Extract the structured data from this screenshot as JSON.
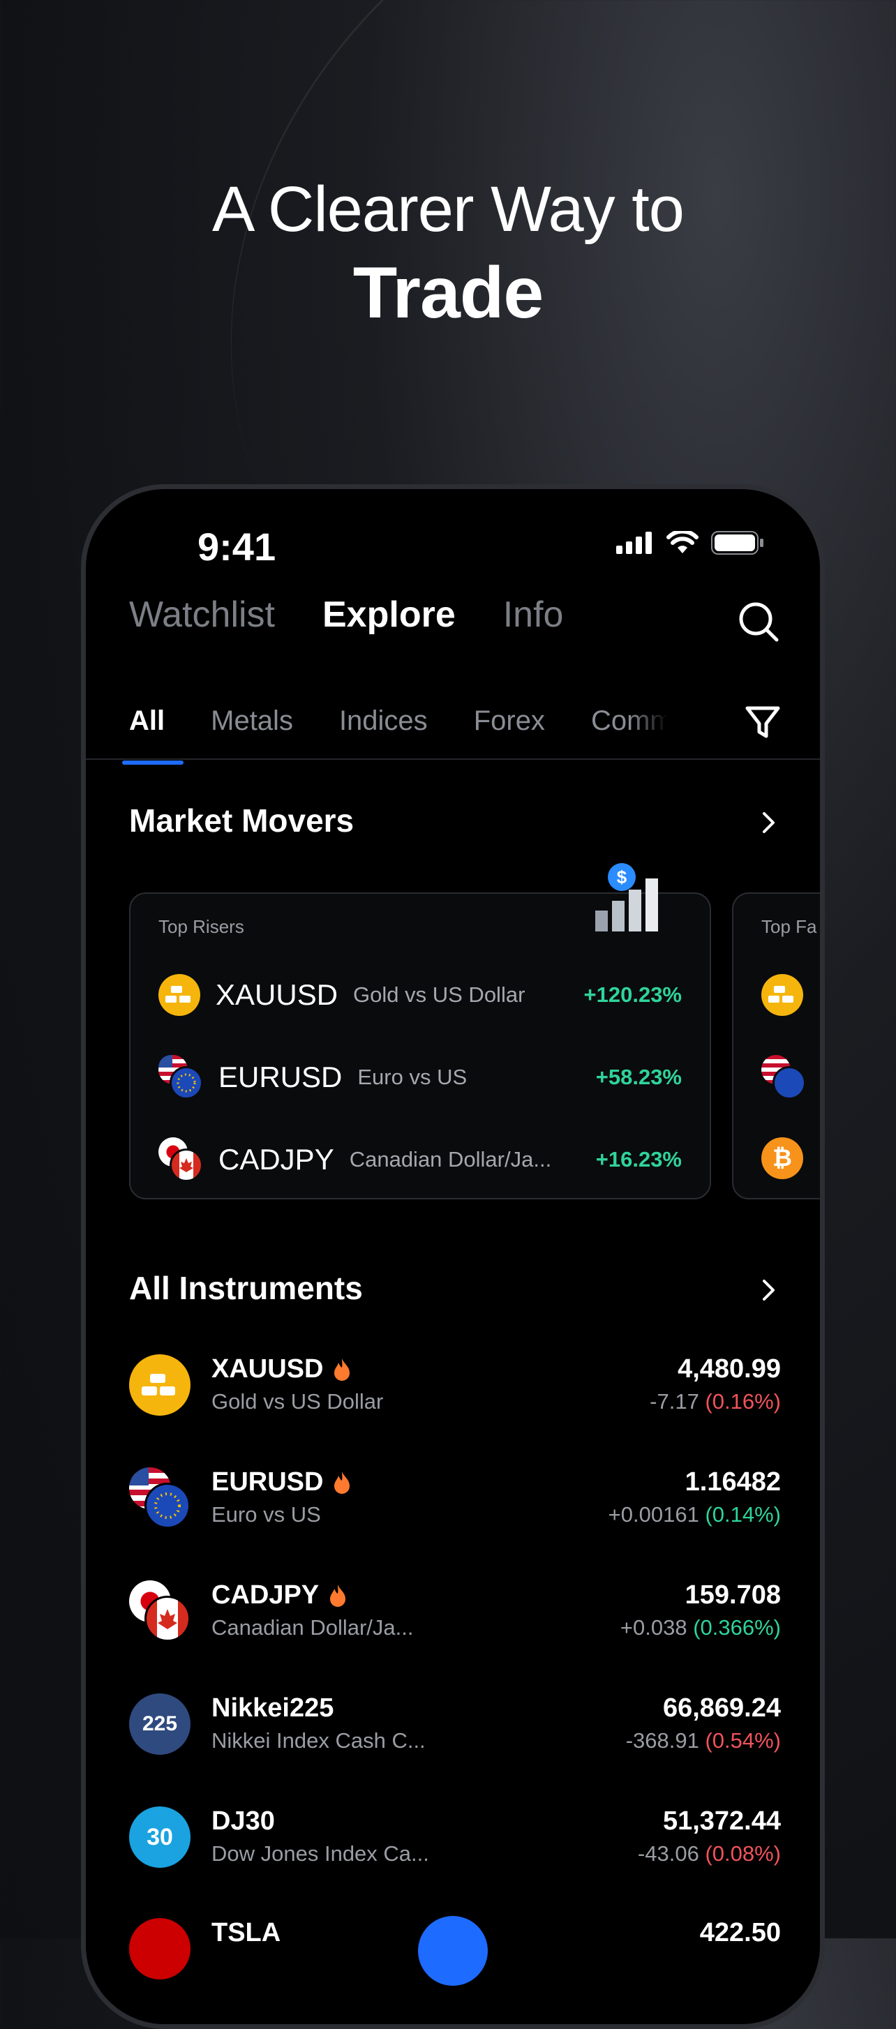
{
  "headline": {
    "line1": "A Clearer Way to",
    "line2": "Trade"
  },
  "status_bar": {
    "time": "9:41"
  },
  "top_tabs": [
    {
      "label": "Watchlist",
      "active": false
    },
    {
      "label": "Explore",
      "active": true
    },
    {
      "label": "Info",
      "active": false
    }
  ],
  "sub_tabs": [
    {
      "label": "All",
      "active": true
    },
    {
      "label": "Metals",
      "active": false
    },
    {
      "label": "Indices",
      "active": false
    },
    {
      "label": "Forex",
      "active": false
    },
    {
      "label": "Comm",
      "active": false
    }
  ],
  "market_movers": {
    "title": "Market Movers",
    "top_risers": {
      "label": "Top Risers",
      "items": [
        {
          "symbol": "XAUUSD",
          "name": "Gold vs US Dollar",
          "change": "+120.23%"
        },
        {
          "symbol": "EURUSD",
          "name": "Euro vs US",
          "change": "+58.23%"
        },
        {
          "symbol": "CADJPY",
          "name": "Canadian Dollar/Ja...",
          "change": "+16.23%"
        }
      ]
    },
    "top_fallers": {
      "label": "Top Fa"
    }
  },
  "all_instruments": {
    "title": "All Instruments",
    "items": [
      {
        "symbol": "XAUUSD",
        "name": "Gold vs US Dollar",
        "price": "4,480.99",
        "delta": "-7.17",
        "pct": "(0.16%)",
        "hot": true
      },
      {
        "symbol": "EURUSD",
        "name": "Euro vs US",
        "price": "1.16482",
        "delta": "+0.00161",
        "pct": "(0.14%)",
        "hot": true
      },
      {
        "symbol": "CADJPY",
        "name": "Canadian Dollar/Ja...",
        "price": "159.708",
        "delta": "+0.038",
        "pct": "(0.366%)",
        "hot": true
      },
      {
        "symbol": "Nikkei225",
        "name": "Nikkei Index Cash C...",
        "badge": "225",
        "price": "66,869.24",
        "delta": "-368.91",
        "pct": "(0.54%)",
        "hot": false
      },
      {
        "symbol": "DJ30",
        "name": "Dow Jones Index Ca...",
        "badge": "30",
        "price": "51,372.44",
        "delta": "-43.06",
        "pct": "(0.08%)",
        "hot": false
      },
      {
        "symbol": "TSLA",
        "price": "422.50"
      }
    ]
  },
  "icons": [
    "search-icon",
    "filter-icon",
    "chevron-right-icon",
    "flame-icon",
    "gold-bars-icon",
    "bitcoin-icon",
    "signal-icon",
    "wifi-icon",
    "battery-icon"
  ],
  "colors": {
    "accent": "#1e6bff",
    "up": "#2fd49a",
    "down": "#f0535b",
    "gold": "#f5b50d",
    "hot": "#ff7a2e"
  }
}
